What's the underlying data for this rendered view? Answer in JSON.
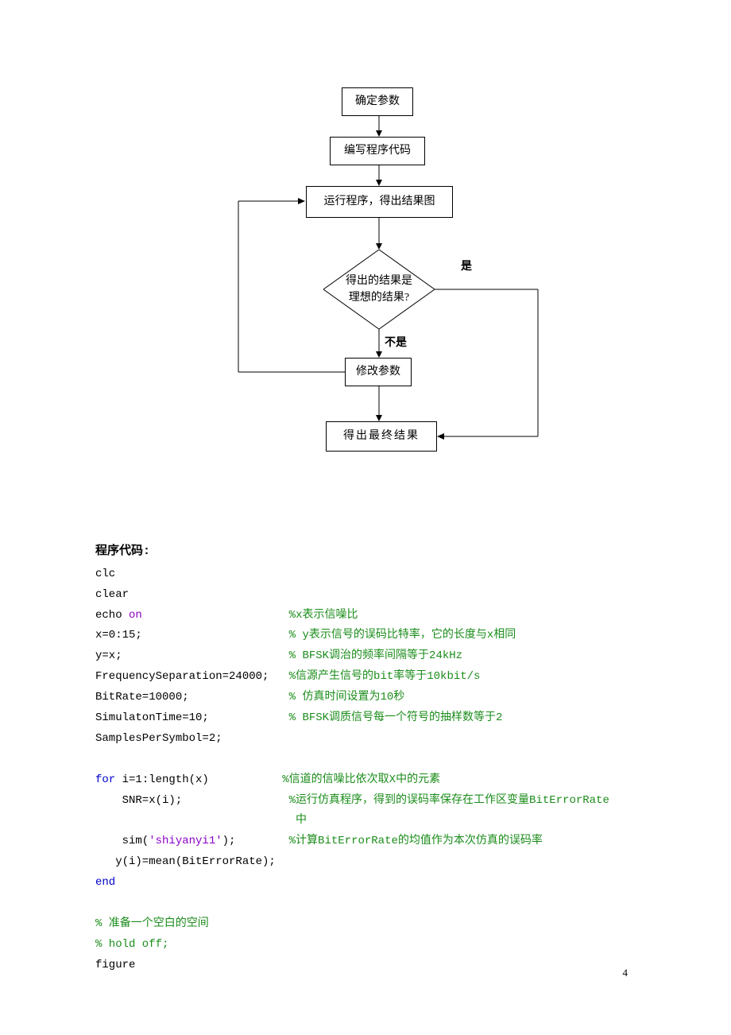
{
  "flow": {
    "b1": "确定参数",
    "b2": "编写程序代码",
    "b3": "运行程序，得出结果图",
    "d1a": "得出的结果是",
    "d1b": "理想的结果?",
    "yes": "是",
    "no": "不是",
    "b4": "修改参数",
    "b5": "得出最终结果"
  },
  "code": {
    "heading": "程序代码:",
    "lines": [
      {
        "t": "clc"
      },
      {
        "t": "clear"
      },
      {
        "t": "echo ",
        "kw": "on",
        "pad": "                      ",
        "c": "%x表示信噪比"
      },
      {
        "t": "x=0:15;",
        "pad": "                      ",
        "c": "% y表示信号的误码比特率，它的长度与x相同"
      },
      {
        "t": "y=x;",
        "pad": "                         ",
        "c": "% BFSK调治的频率间隔等于24kHz"
      },
      {
        "t": "FrequencySeparation=24000;",
        "pad": "   ",
        "c": "%信源产生信号的bit率等于10kbit/s"
      },
      {
        "t": "BitRate=10000;",
        "pad": "               ",
        "c": "% 仿真时间设置为10秒"
      },
      {
        "t": "SimulatonTime=10;",
        "pad": "            ",
        "c": "% BFSK调质信号每一个符号的抽样数等于2"
      },
      {
        "t": "SamplesPerSymbol=2;"
      },
      {
        "blank": true
      },
      {
        "kw2": "for",
        "t": " i=1:length(x)",
        "pad": "           ",
        "c": "%信道的信噪比依次取X中的元素"
      },
      {
        "t": "    SNR=x(i);",
        "pad": "                ",
        "c": "%运行仿真程序，得到的误码率保存在工作区变量BitErrorRate"
      },
      {
        "pad": "                              ",
        "c": "中"
      },
      {
        "t": "    sim(",
        "str": "'shiyanyi1'",
        "t2": ");",
        "pad": "        ",
        "c": "%计算BitErrorRate的均值作为本次仿真的误码率"
      },
      {
        "t": "   y(i)=mean(BitErrorRate);"
      },
      {
        "kw2": "end"
      },
      {
        "blank": true
      },
      {
        "c": "% 准备一个空白的空间"
      },
      {
        "c": "% hold off;"
      },
      {
        "t": "figure"
      }
    ]
  },
  "pageNum": "4"
}
